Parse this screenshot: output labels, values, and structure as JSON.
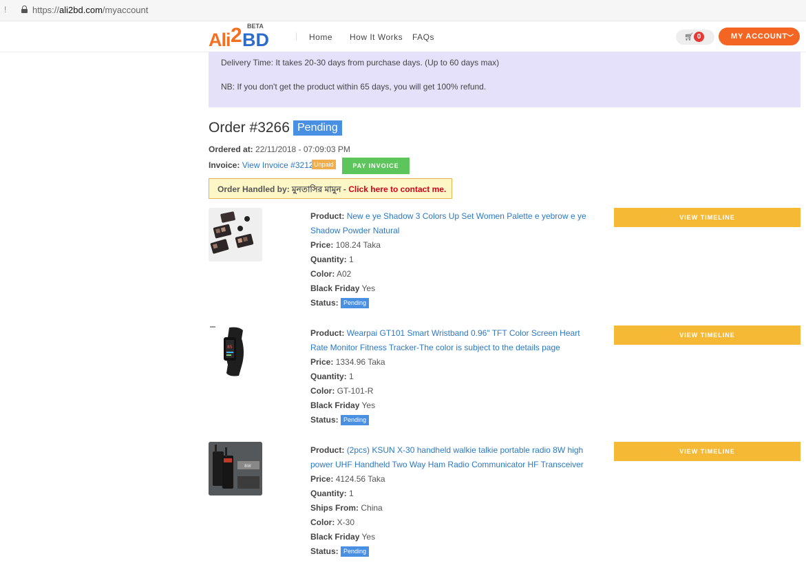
{
  "browser": {
    "url_scheme": "https://",
    "url_domain": "ali2bd.com",
    "url_path": "/myaccount"
  },
  "header": {
    "logo_ali": "Ali",
    "logo_two": "2",
    "logo_bd": "BD",
    "logo_beta": "BETA",
    "nav": [
      "Home",
      "How It Works",
      "FAQs"
    ],
    "cart_icon": "cart-icon",
    "cart_count": "0",
    "account_label": "MY ACCOUNT",
    "account_chevron": "﹀",
    "brand_color": "#f26522"
  },
  "notice": {
    "delivery": "Delivery Time: It takes 20-30 days from purchase days. (Up to 60 days max)",
    "nb": "NB: If you don't get the product within 65 days, you will get 100% refund."
  },
  "order": {
    "title": "Order #3266",
    "status": "Pending",
    "ordered_at_label": "Ordered at:",
    "ordered_at": "22/11/2018 - 07:09:03 PM",
    "invoice_label": "Invoice:",
    "invoice_link": "View Invoice #3212",
    "invoice_status": "Unpaid",
    "pay_label": "PAY INVOICE",
    "handled_label": "Order Handled by: মুনতাসির মামুন - ",
    "contact_label": "Click here to contact me."
  },
  "labels": {
    "product": "Product:",
    "price": "Price:",
    "quantity": "Quantity:",
    "color": "Color:",
    "ships_from": "Ships From:",
    "black_friday": "Black Friday",
    "status": "Status:",
    "view_timeline": "VIEW TIMELINE"
  },
  "products": [
    {
      "name": "New e ye Shadow 3 Colors Up Set Women Palette e yebrow e ye Shadow Powder Natural",
      "price": "108.24 Taka",
      "quantity": "1",
      "color": "A02",
      "black_friday": "Yes",
      "status": "Pending"
    },
    {
      "name": "Wearpai GT101 Smart Wristband 0.96\" TFT Color Screen Heart Rate Monitor Fitness Tracker-The color is subject to the details page",
      "price": "1334.96 Taka",
      "quantity": "1",
      "color": "GT-101-R",
      "black_friday": "Yes",
      "status": "Pending"
    },
    {
      "name": "(2pcs) KSUN X-30 handheld walkie talkie portable radio 8W high power UHF Handheld Two Way Ham Radio Communicator HF Transceiver",
      "price": "4124.56 Taka",
      "quantity": "1",
      "ships_from": "China",
      "color": "X-30",
      "black_friday": "Yes",
      "status": "Pending"
    }
  ]
}
